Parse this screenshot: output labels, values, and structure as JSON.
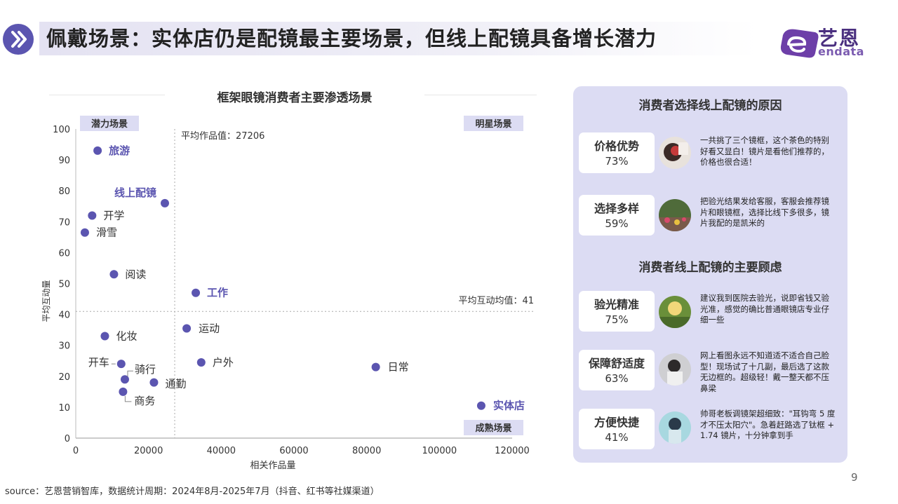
{
  "header": {
    "title": "佩戴场景：实体店仍是配镜最主要场景，但线上配镜具备增长潜力",
    "logo_cn": "艺恩",
    "logo_en": "endata",
    "accent": "#5b55b0"
  },
  "chart_data": {
    "type": "scatter",
    "title": "框架眼镜消费者主要渗透场景",
    "xlabel": "相关作品量",
    "ylabel": "平均互动量",
    "xlim": [
      0,
      120000
    ],
    "ylim": [
      0,
      100
    ],
    "x_ticks": [
      "0",
      "20000",
      "40000",
      "60000",
      "80000",
      "100000",
      "120000"
    ],
    "y_ticks": [
      "0",
      "10",
      "20",
      "30",
      "40",
      "50",
      "60",
      "70",
      "80",
      "90",
      "100"
    ],
    "x_ref": 27206,
    "y_ref": 41,
    "x_ref_label": "平均作品值：27206",
    "y_ref_label": "平均互动均值：41",
    "quadrants": {
      "top_left": "潜力场景",
      "top_right": "明星场景",
      "bottom_right": "成熟场景"
    },
    "point_color": "#5b55b0",
    "highlight_color": "#5b55b0",
    "points": [
      {
        "label": "旅游",
        "x": 6000,
        "y": 93,
        "highlight": true
      },
      {
        "label": "线上配镜",
        "x": 24500,
        "y": 76,
        "highlight": true
      },
      {
        "label": "开学",
        "x": 4500,
        "y": 72,
        "highlight": false
      },
      {
        "label": "滑雪",
        "x": 2500,
        "y": 66.5,
        "highlight": false
      },
      {
        "label": "阅读",
        "x": 10500,
        "y": 53,
        "highlight": false
      },
      {
        "label": "工作",
        "x": 33000,
        "y": 47,
        "highlight": true
      },
      {
        "label": "运动",
        "x": 30500,
        "y": 35.5,
        "highlight": false
      },
      {
        "label": "化妆",
        "x": 8000,
        "y": 33,
        "highlight": false
      },
      {
        "label": "户外",
        "x": 34500,
        "y": 24.5,
        "highlight": false
      },
      {
        "label": "开车",
        "x": 12500,
        "y": 24,
        "highlight": false
      },
      {
        "label": "骑行",
        "x": 13500,
        "y": 19,
        "highlight": false
      },
      {
        "label": "通勤",
        "x": 21500,
        "y": 18,
        "highlight": false
      },
      {
        "label": "商务",
        "x": 13000,
        "y": 15,
        "highlight": false
      },
      {
        "label": "日常",
        "x": 82500,
        "y": 23,
        "highlight": false
      },
      {
        "label": "实体店",
        "x": 111500,
        "y": 10.5,
        "highlight": true
      }
    ]
  },
  "panel": {
    "heading_reasons": "消费者选择线上配镜的原因",
    "heading_concerns": "消费者线上配镜的主要顾虑",
    "reasons": [
      {
        "label": "价格优势",
        "pct": "73%",
        "quote": "一共挑了三个镜框，这个茶色的特别好看又显白！镜片是看他们推荐的，价格也很合适！"
      },
      {
        "label": "选择多样",
        "pct": "59%",
        "quote": "把验光结果发给客服，客服会推荐镜片和眼镜框，选择比线下多很多，镜片我配的是凯米的"
      }
    ],
    "concerns": [
      {
        "label": "验光精准",
        "pct": "75%",
        "quote": "建议我到医院去验光，说即省钱又验光准，感觉的确比普通眼镜店专业仔细一些"
      },
      {
        "label": "保障舒适度",
        "pct": "63%",
        "quote": "网上看图永远不知道适不适合自己脸型！现场试了十几副，最后选了这款无边框的。超级轻！戴一整天都不压鼻梁"
      },
      {
        "label": "方便快捷",
        "pct": "41%",
        "quote": "帅哥老板调镜架超细致：\"耳钩弯 5 度才不压太阳穴\"。急着赶路选了钛框 + 1.74 镜片，十分钟拿到手"
      }
    ]
  },
  "footer": {
    "page_number": "9",
    "source": "source：艺恩营销智库，数据统计周期：2024年8月-2025年7月（抖音、红书等社媒渠道）"
  }
}
